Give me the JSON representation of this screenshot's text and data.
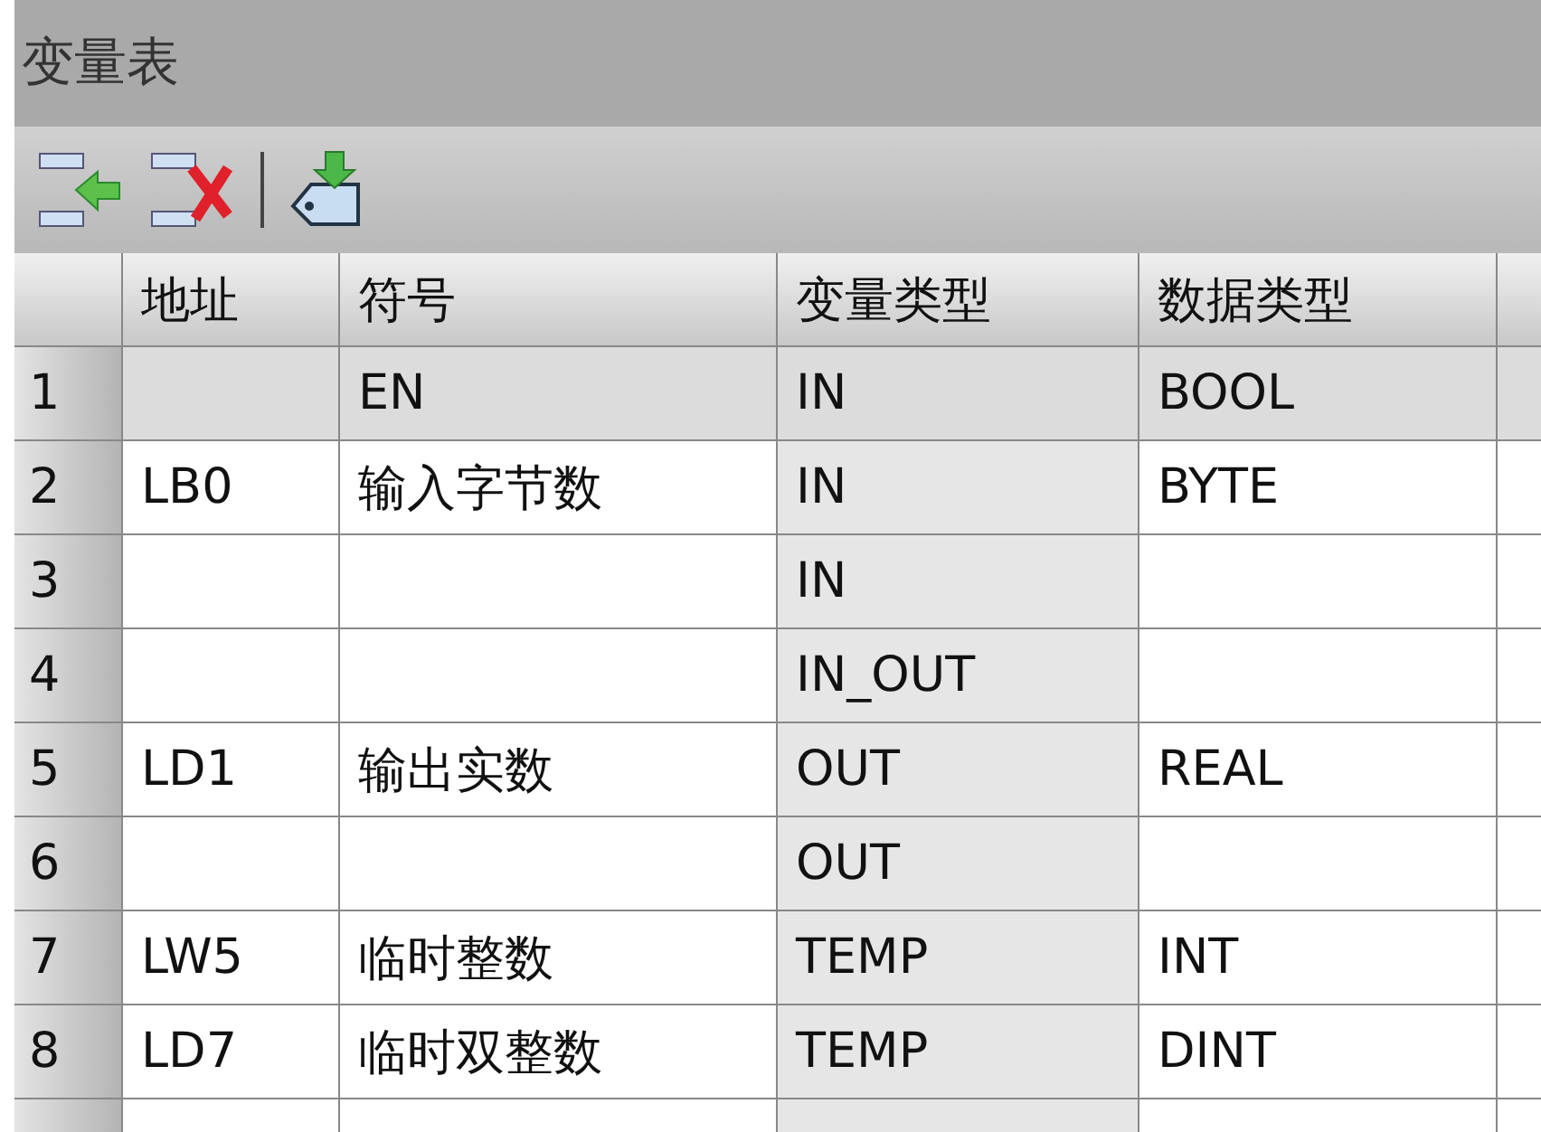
{
  "window": {
    "title": "变量表"
  },
  "toolbar": [
    {
      "kind": "insert"
    },
    {
      "kind": "delete"
    },
    {
      "kind": "separator"
    },
    {
      "kind": "download"
    }
  ],
  "table": {
    "columns": [
      "地址",
      "符号",
      "变量类型",
      "数据类型"
    ],
    "rows": [
      {
        "number": "1",
        "locked": true,
        "cells": [
          "",
          "EN",
          "IN",
          "BOOL"
        ]
      },
      {
        "number": "2",
        "locked": false,
        "cells": [
          "LB0",
          "输入字节数",
          "IN",
          "BYTE"
        ]
      },
      {
        "number": "3",
        "locked": false,
        "cells": [
          "",
          "",
          "IN",
          ""
        ]
      },
      {
        "number": "4",
        "locked": false,
        "cells": [
          "",
          "",
          "IN_OUT",
          ""
        ]
      },
      {
        "number": "5",
        "locked": false,
        "cells": [
          "LD1",
          "输出实数",
          "OUT",
          "REAL"
        ]
      },
      {
        "number": "6",
        "locked": false,
        "cells": [
          "",
          "",
          "OUT",
          ""
        ]
      },
      {
        "number": "7",
        "locked": false,
        "cells": [
          "LW5",
          "临时整数",
          "TEMP",
          "INT"
        ]
      },
      {
        "number": "8",
        "locked": false,
        "cells": [
          "LD7",
          "临时双整数",
          "TEMP",
          "DINT"
        ]
      }
    ]
  }
}
